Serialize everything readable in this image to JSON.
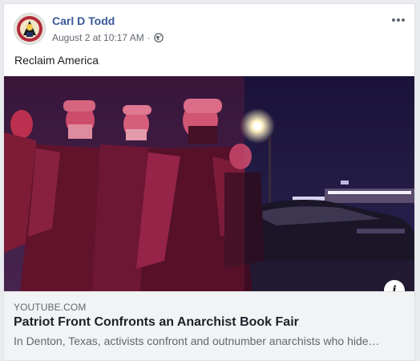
{
  "post": {
    "author": "Carl D Todd",
    "timestamp": "August 2 at 10:17 AM",
    "separator": "·",
    "privacy_icon": "globe-icon",
    "text": "Reclaim America",
    "options_icon": "more-options-icon"
  },
  "link_preview": {
    "domain": "YOUTUBE.COM",
    "title": "Patriot Front Confronts an Anarchist Book Fair",
    "description": "In Denton, Texas, activists confront and outnumber anarchists who hide…",
    "info_icon_label": "i"
  },
  "colors": {
    "author_link": "#385898",
    "card_bg": "#f2f3f5",
    "image_tint": "#c8284a"
  }
}
